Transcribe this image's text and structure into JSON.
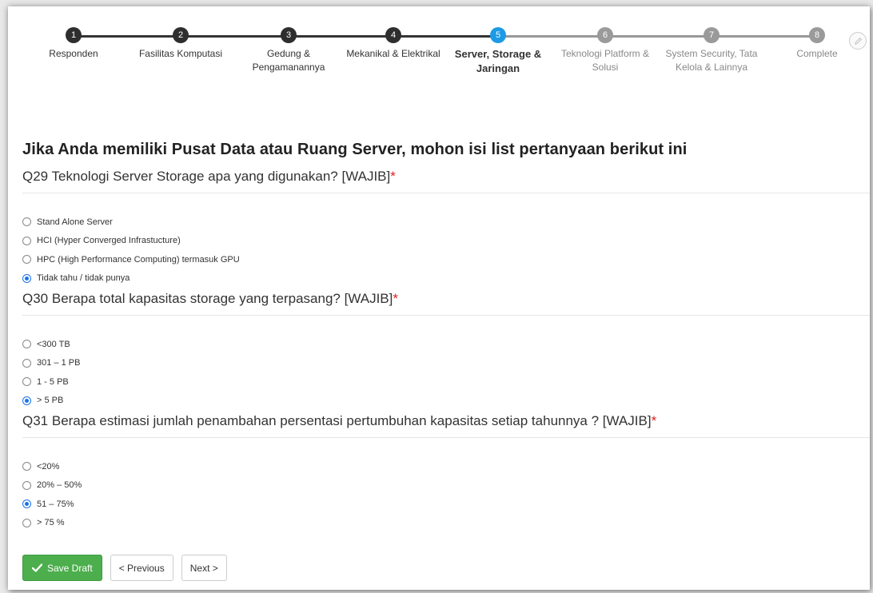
{
  "steps": [
    {
      "number": "1",
      "label": "Responden",
      "state": "done"
    },
    {
      "number": "2",
      "label": "Fasilitas Komputasi",
      "state": "done"
    },
    {
      "number": "3",
      "label": "Gedung & Pengamanannya",
      "state": "done"
    },
    {
      "number": "4",
      "label": "Mekanikal & Elektrikal",
      "state": "done"
    },
    {
      "number": "5",
      "label": "Server, Storage & Jaringan",
      "state": "active"
    },
    {
      "number": "6",
      "label": "Teknologi Platform & Solusi",
      "state": "todo"
    },
    {
      "number": "7",
      "label": "System Security, Tata Kelola & Lainnya",
      "state": "todo"
    },
    {
      "number": "8",
      "label": "Complete",
      "state": "todo"
    }
  ],
  "headline": "Jika Anda memiliki Pusat Data atau Ruang Server, mohon isi list pertanyaan berikut ini",
  "questions": [
    {
      "text": "Q29 Teknologi Server Storage apa yang digunakan? [WAJIB]",
      "required_mark": "*",
      "options": [
        {
          "label": "Stand Alone Server",
          "selected": false
        },
        {
          "label": "HCI (Hyper Converged Infrastucture)",
          "selected": false
        },
        {
          "label": "HPC (High Performance Computing) termasuk GPU",
          "selected": false
        },
        {
          "label": "Tidak tahu / tidak punya",
          "selected": true
        }
      ]
    },
    {
      "text": "Q30 Berapa total kapasitas storage yang terpasang? [WAJIB]",
      "required_mark": "*",
      "options": [
        {
          "label": "<300 TB",
          "selected": false
        },
        {
          "label": "301 – 1 PB",
          "selected": false
        },
        {
          "label": "1 - 5 PB",
          "selected": false
        },
        {
          "label": "> 5 PB",
          "selected": true
        }
      ]
    },
    {
      "text": "Q31 Berapa estimasi jumlah penambahan persentasi pertumbuhan kapasitas setiap tahunnya ? [WAJIB]",
      "required_mark": "*",
      "options": [
        {
          "label": "<20%",
          "selected": false
        },
        {
          "label": "20% – 50%",
          "selected": false
        },
        {
          "label": "51 – 75%",
          "selected": true
        },
        {
          "label": "> 75 %",
          "selected": false
        }
      ]
    }
  ],
  "buttons": {
    "save_draft": "Save Draft",
    "previous": "< Previous",
    "next": "Next >"
  },
  "colors": {
    "accent": "#1c9ae6",
    "save": "#4cae4c",
    "required": "#e02020",
    "done_step": "#2e2e2e",
    "todo_step": "#9a9a9a"
  },
  "icons": {
    "edit": "pencil-icon",
    "save": "check-icon"
  }
}
